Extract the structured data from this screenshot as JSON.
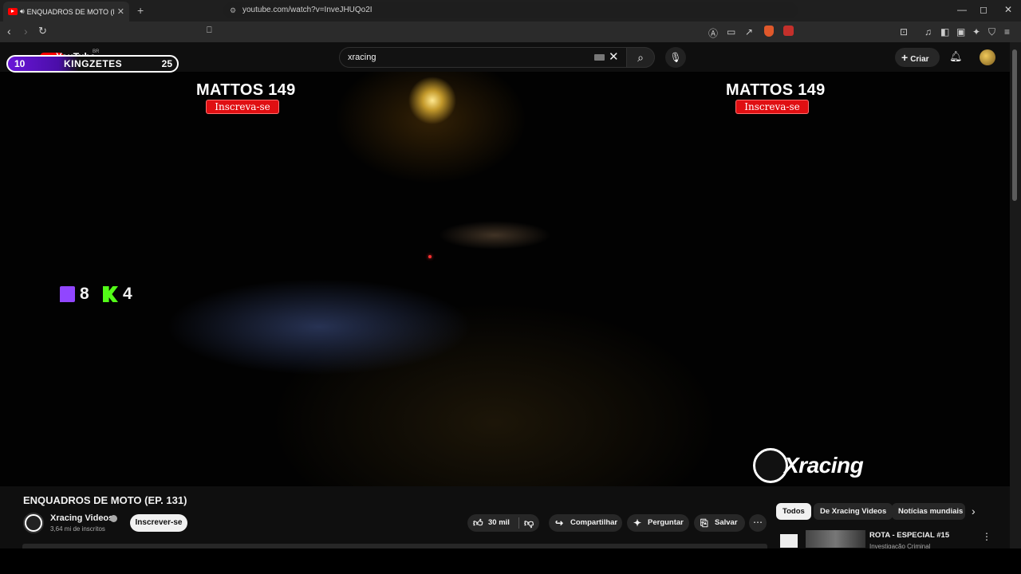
{
  "browser": {
    "tab_title": "ENQUADROS DE MOTO (EP.",
    "tab_close": "✕",
    "new_tab": "+",
    "url": "youtube.com/watch?v=InveJHUQo2I",
    "window_controls": [
      "—",
      "◻",
      "✕"
    ]
  },
  "youtube": {
    "logo_text": "YouTube",
    "country": "BR",
    "search_value": "xracing",
    "create_label": "Criar"
  },
  "overlay": {
    "left_score": "10",
    "name": "KINGZETES",
    "right_score": "25",
    "twitch_count": "8",
    "kick_count": "4",
    "watermark_name_left": "MATTOS 149",
    "watermark_sub_left": "Inscreva-se",
    "watermark_name_right": "MATTOS 149",
    "watermark_sub_right": "Inscreva-se",
    "brand": "Xracing"
  },
  "video": {
    "title": "ENQUADROS DE MOTO (EP. 131)",
    "channel": "Xracing Videos",
    "subscribers": "3,64 mi de inscritos",
    "subscribe_label": "Inscrever-se",
    "likes": "30 mil",
    "share_label": "Compartilhar",
    "ask_label": "Perguntar",
    "save_label": "Salvar"
  },
  "chips": [
    "Todos",
    "De Xracing Videos",
    "Notícias mundiais"
  ],
  "recommendation": {
    "title": "ROTA - ESPECIAL #15",
    "channel": "Investigação Criminal"
  },
  "colors": {
    "yt_red": "#ff0000",
    "twitch": "#9146ff",
    "kick": "#53fc18",
    "overlay_purple": "#6a16d8"
  }
}
